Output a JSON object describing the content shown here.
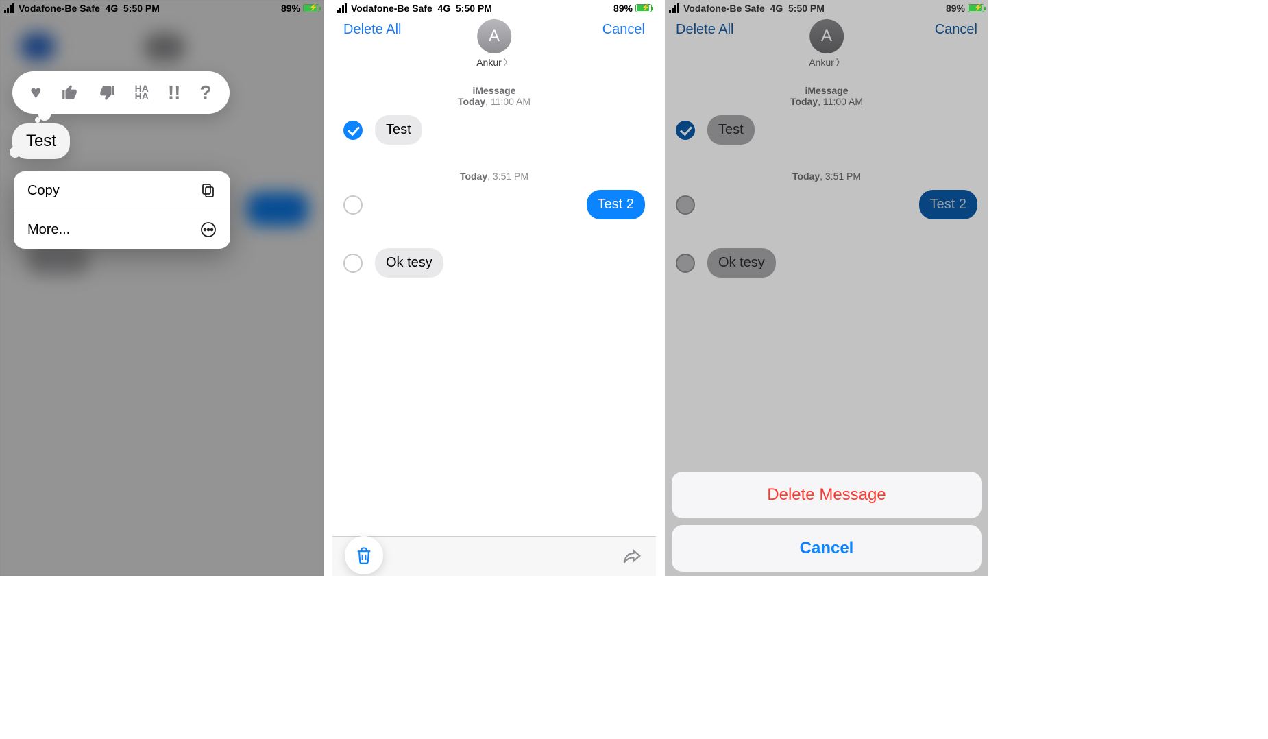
{
  "status": {
    "carrier": "Vodafone-Be Safe",
    "network": "4G",
    "time": "5:50 PM",
    "battery_pct": "89%"
  },
  "panel1": {
    "reactions": [
      "heart",
      "thumbs-up",
      "thumbs-down",
      "haha",
      "exclaim",
      "question"
    ],
    "focused_message": "Test",
    "menu": {
      "copy": "Copy",
      "more": "More..."
    }
  },
  "thread": {
    "delete_all": "Delete All",
    "cancel": "Cancel",
    "contact_initial": "A",
    "contact_name": "Ankur",
    "header_service": "iMessage",
    "ts1_day": "Today",
    "ts1_time": "11:00 AM",
    "ts2_day": "Today",
    "ts2_time": "3:51 PM",
    "msg1": "Test",
    "msg2": "Test 2",
    "msg3": "Ok tesy"
  },
  "actionsheet": {
    "delete": "Delete Message",
    "cancel": "Cancel"
  }
}
